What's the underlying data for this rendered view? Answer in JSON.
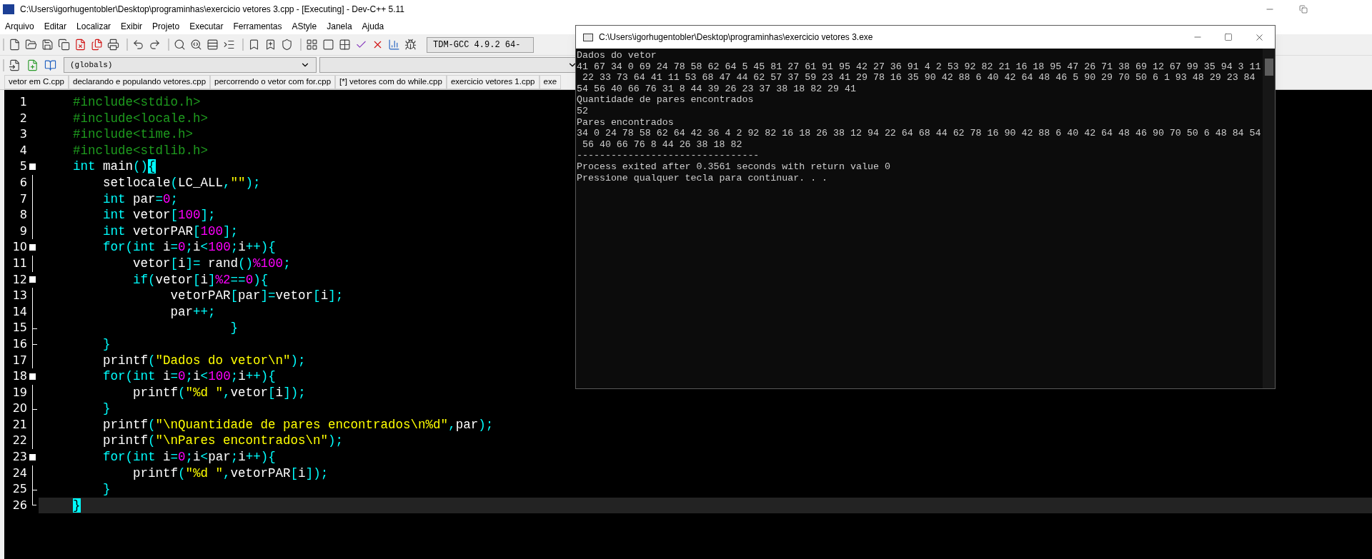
{
  "window": {
    "title": "C:\\Users\\igorhugentobler\\Desktop\\programinhas\\exercicio vetores 3.cpp - [Executing] - Dev-C++ 5.11"
  },
  "menu": [
    "Arquivo",
    "Editar",
    "Localizar",
    "Exibir",
    "Projeto",
    "Executar",
    "Ferramentas",
    "AStyle",
    "Janela",
    "Ajuda"
  ],
  "toolbar": {
    "compiler": "TDM-GCC 4.9.2 64-",
    "scope": "(globals)"
  },
  "tabs": [
    {
      "label": "vetor em C.cpp",
      "selected": false
    },
    {
      "label": "declarando e populando vetores.cpp",
      "selected": false
    },
    {
      "label": "percorrendo o vetor com for.cpp",
      "selected": false
    },
    {
      "label": "[*] vetores com do while.cpp",
      "selected": false
    },
    {
      "label": "exercicio vetores 1.cpp",
      "selected": false
    },
    {
      "label": "exe",
      "selected": false
    }
  ],
  "editor": {
    "lines": [
      {
        "number": "1",
        "kind": "none",
        "current": false,
        "tokens": [
          {
            "kind": "pre",
            "text": "    #include<stdio.h>"
          }
        ]
      },
      {
        "number": "2",
        "kind": "none",
        "current": false,
        "tokens": [
          {
            "kind": "pre",
            "text": "    #include<locale.h>"
          }
        ]
      },
      {
        "number": "3",
        "kind": "none",
        "current": false,
        "tokens": [
          {
            "kind": "pre",
            "text": "    #include<time.h>"
          }
        ]
      },
      {
        "number": "4",
        "kind": "none",
        "current": false,
        "tokens": [
          {
            "kind": "pre",
            "text": "    #include<stdlib.h>"
          }
        ]
      },
      {
        "number": "5",
        "kind": "start",
        "current": false,
        "tokens": [
          {
            "kind": "kw",
            "text": "    int"
          },
          {
            "kind": "id",
            "text": " main"
          },
          {
            "kind": "kw",
            "text": "()"
          },
          {
            "kind": "match",
            "text": "{"
          }
        ]
      },
      {
        "number": "6",
        "kind": "line",
        "current": false,
        "tokens": [
          {
            "kind": "id",
            "text": "        setlocale"
          },
          {
            "kind": "kw",
            "text": "("
          },
          {
            "kind": "id",
            "text": "LC_ALL"
          },
          {
            "kind": "kw",
            "text": ","
          },
          {
            "kind": "str",
            "text": "\"\""
          },
          {
            "kind": "kw",
            "text": ");"
          }
        ]
      },
      {
        "number": "7",
        "kind": "line",
        "current": false,
        "tokens": [
          {
            "kind": "kw",
            "text": "        int"
          },
          {
            "kind": "id",
            "text": " par"
          },
          {
            "kind": "kw",
            "text": "="
          },
          {
            "kind": "num",
            "text": "0"
          },
          {
            "kind": "kw",
            "text": ";"
          }
        ]
      },
      {
        "number": "8",
        "kind": "line",
        "current": false,
        "tokens": [
          {
            "kind": "kw",
            "text": "        int"
          },
          {
            "kind": "id",
            "text": " vetor"
          },
          {
            "kind": "kw",
            "text": "["
          },
          {
            "kind": "num",
            "text": "100"
          },
          {
            "kind": "kw",
            "text": "];"
          }
        ]
      },
      {
        "number": "9",
        "kind": "line",
        "current": false,
        "tokens": [
          {
            "kind": "kw",
            "text": "        int"
          },
          {
            "kind": "id",
            "text": " vetorPAR"
          },
          {
            "kind": "kw",
            "text": "["
          },
          {
            "kind": "num",
            "text": "100"
          },
          {
            "kind": "kw",
            "text": "];"
          }
        ]
      },
      {
        "number": "10",
        "kind": "start",
        "current": false,
        "tokens": [
          {
            "kind": "kw",
            "text": "        for(int"
          },
          {
            "kind": "id",
            "text": " i"
          },
          {
            "kind": "kw",
            "text": "="
          },
          {
            "kind": "num",
            "text": "0"
          },
          {
            "kind": "kw",
            "text": ";"
          },
          {
            "kind": "id",
            "text": "i"
          },
          {
            "kind": "kw",
            "text": "<"
          },
          {
            "kind": "num",
            "text": "100"
          },
          {
            "kind": "kw",
            "text": ";"
          },
          {
            "kind": "id",
            "text": "i"
          },
          {
            "kind": "kw",
            "text": "++){"
          }
        ]
      },
      {
        "number": "11",
        "kind": "line",
        "current": false,
        "tokens": [
          {
            "kind": "id",
            "text": "            vetor"
          },
          {
            "kind": "kw",
            "text": "["
          },
          {
            "kind": "id",
            "text": "i"
          },
          {
            "kind": "kw",
            "text": "]="
          },
          {
            "kind": "id",
            "text": " rand"
          },
          {
            "kind": "kw",
            "text": "()"
          },
          {
            "kind": "num",
            "text": "%100"
          },
          {
            "kind": "kw",
            "text": ";"
          }
        ]
      },
      {
        "number": "12",
        "kind": "start",
        "current": false,
        "tokens": [
          {
            "kind": "kw",
            "text": "            if("
          },
          {
            "kind": "id",
            "text": "vetor"
          },
          {
            "kind": "kw",
            "text": "["
          },
          {
            "kind": "id",
            "text": "i"
          },
          {
            "kind": "kw",
            "text": "]"
          },
          {
            "kind": "num",
            "text": "%2"
          },
          {
            "kind": "kw",
            "text": "=="
          },
          {
            "kind": "num",
            "text": "0"
          },
          {
            "kind": "kw",
            "text": "){"
          }
        ]
      },
      {
        "number": "13",
        "kind": "line",
        "current": false,
        "tokens": [
          {
            "kind": "id",
            "text": "                 vetorPAR"
          },
          {
            "kind": "kw",
            "text": "["
          },
          {
            "kind": "id",
            "text": "par"
          },
          {
            "kind": "kw",
            "text": "]="
          },
          {
            "kind": "id",
            "text": "vetor"
          },
          {
            "kind": "kw",
            "text": "["
          },
          {
            "kind": "id",
            "text": "i"
          },
          {
            "kind": "kw",
            "text": "];"
          }
        ]
      },
      {
        "number": "14",
        "kind": "line",
        "current": false,
        "tokens": [
          {
            "kind": "id",
            "text": "                 par"
          },
          {
            "kind": "kw",
            "text": "++;"
          }
        ]
      },
      {
        "number": "15",
        "kind": "end",
        "current": false,
        "tokens": [
          {
            "kind": "kw",
            "text": "                         }"
          }
        ]
      },
      {
        "number": "16",
        "kind": "end",
        "current": false,
        "tokens": [
          {
            "kind": "kw",
            "text": "        }"
          }
        ]
      },
      {
        "number": "17",
        "kind": "line",
        "current": false,
        "tokens": [
          {
            "kind": "id",
            "text": "        printf"
          },
          {
            "kind": "kw",
            "text": "("
          },
          {
            "kind": "str",
            "text": "\"Dados do vetor\\n\""
          },
          {
            "kind": "kw",
            "text": ");"
          }
        ]
      },
      {
        "number": "18",
        "kind": "start",
        "current": false,
        "tokens": [
          {
            "kind": "kw",
            "text": "        for(int"
          },
          {
            "kind": "id",
            "text": " i"
          },
          {
            "kind": "kw",
            "text": "="
          },
          {
            "kind": "num",
            "text": "0"
          },
          {
            "kind": "kw",
            "text": ";"
          },
          {
            "kind": "id",
            "text": "i"
          },
          {
            "kind": "kw",
            "text": "<"
          },
          {
            "kind": "num",
            "text": "100"
          },
          {
            "kind": "kw",
            "text": ";"
          },
          {
            "kind": "id",
            "text": "i"
          },
          {
            "kind": "kw",
            "text": "++){"
          }
        ]
      },
      {
        "number": "19",
        "kind": "line",
        "current": false,
        "tokens": [
          {
            "kind": "id",
            "text": "            printf"
          },
          {
            "kind": "kw",
            "text": "("
          },
          {
            "kind": "str",
            "text": "\"%d \""
          },
          {
            "kind": "kw",
            "text": ","
          },
          {
            "kind": "id",
            "text": "vetor"
          },
          {
            "kind": "kw",
            "text": "["
          },
          {
            "kind": "id",
            "text": "i"
          },
          {
            "kind": "kw",
            "text": "]);"
          }
        ]
      },
      {
        "number": "20",
        "kind": "end",
        "current": false,
        "tokens": [
          {
            "kind": "kw",
            "text": "        }"
          }
        ]
      },
      {
        "number": "21",
        "kind": "line",
        "current": false,
        "tokens": [
          {
            "kind": "id",
            "text": "        printf"
          },
          {
            "kind": "kw",
            "text": "("
          },
          {
            "kind": "str",
            "text": "\"\\nQuantidade de pares encontrados\\n%d\""
          },
          {
            "kind": "kw",
            "text": ","
          },
          {
            "kind": "id",
            "text": "par"
          },
          {
            "kind": "kw",
            "text": ");"
          }
        ]
      },
      {
        "number": "22",
        "kind": "line",
        "current": false,
        "tokens": [
          {
            "kind": "id",
            "text": "        printf"
          },
          {
            "kind": "kw",
            "text": "("
          },
          {
            "kind": "str",
            "text": "\"\\nPares encontrados\\n\""
          },
          {
            "kind": "kw",
            "text": ");"
          }
        ]
      },
      {
        "number": "23",
        "kind": "start",
        "current": false,
        "tokens": [
          {
            "kind": "kw",
            "text": "        for(int"
          },
          {
            "kind": "id",
            "text": " i"
          },
          {
            "kind": "kw",
            "text": "="
          },
          {
            "kind": "num",
            "text": "0"
          },
          {
            "kind": "kw",
            "text": ";"
          },
          {
            "kind": "id",
            "text": "i"
          },
          {
            "kind": "kw",
            "text": "<"
          },
          {
            "kind": "id",
            "text": "par"
          },
          {
            "kind": "kw",
            "text": ";"
          },
          {
            "kind": "id",
            "text": "i"
          },
          {
            "kind": "kw",
            "text": "++){"
          }
        ]
      },
      {
        "number": "24",
        "kind": "line",
        "current": false,
        "tokens": [
          {
            "kind": "id",
            "text": "            printf"
          },
          {
            "kind": "kw",
            "text": "("
          },
          {
            "kind": "str",
            "text": "\"%d \""
          },
          {
            "kind": "kw",
            "text": ","
          },
          {
            "kind": "id",
            "text": "vetorPAR"
          },
          {
            "kind": "kw",
            "text": "["
          },
          {
            "kind": "id",
            "text": "i"
          },
          {
            "kind": "kw",
            "text": "]);"
          }
        ]
      },
      {
        "number": "25",
        "kind": "end",
        "current": false,
        "tokens": [
          {
            "kind": "kw",
            "text": "        }"
          }
        ]
      },
      {
        "number": "26",
        "kind": "last",
        "current": true,
        "tokens": [
          {
            "kind": "match",
            "text": "    }"
          }
        ]
      }
    ]
  },
  "console": {
    "title": "C:\\Users\\igorhugentobler\\Desktop\\programinhas\\exercicio vetores 3.exe",
    "lines": [
      "Dados do vetor",
      "41 67 34 0 69 24 78 58 62 64 5 45 81 27 61 91 95 42 27 36 91 4 2 53 92 82 21 16 18 95 47 26 71 38 69 12 67 99 35 94 3 11",
      " 22 33 73 64 41 11 53 68 47 44 62 57 37 59 23 41 29 78 16 35 90 42 88 6 40 42 64 48 46 5 90 29 70 50 6 1 93 48 29 23 84",
      "54 56 40 66 76 31 8 44 39 26 23 37 38 18 82 29 41",
      "Quantidade de pares encontrados",
      "52",
      "Pares encontrados",
      "34 0 24 78 58 62 64 42 36 4 2 92 82 16 18 26 38 12 94 22 64 68 44 62 78 16 90 42 88 6 40 42 64 48 46 90 70 50 6 48 84 54",
      " 56 40 66 76 8 44 26 38 18 82",
      "--------------------------------",
      "Process exited after 0.3561 seconds with return value 0",
      "Pressione qualquer tecla para continuar. . ."
    ]
  }
}
